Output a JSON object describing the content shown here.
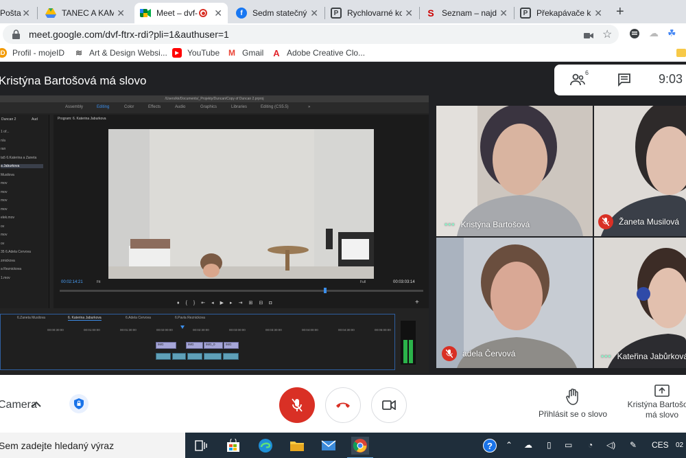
{
  "browser": {
    "tabs": [
      {
        "title": "Pošta",
        "icon": "mail-icon",
        "active": false
      },
      {
        "title": "TANEC A KAMERA",
        "icon": "google-drive-icon",
        "active": false
      },
      {
        "title": "Meet – dvf-ftrx-rdi",
        "icon": "google-meet-icon",
        "active": true
      },
      {
        "title": "Sedm statečných",
        "icon": "facebook-icon",
        "active": false
      },
      {
        "title": "Rychlovarné konvice",
        "icon": "shop-icon",
        "active": false
      },
      {
        "title": "Seznam – najdu tam",
        "icon": "seznam-icon",
        "active": false
      },
      {
        "title": "Překapávače kávy",
        "icon": "shop-icon",
        "active": false
      }
    ],
    "url": "meet.google.com/dvf-ftrx-rdi?pli=1&authuser=1",
    "bookmarks": [
      {
        "label": "Profil - mojeID",
        "icon": "mojeid-icon"
      },
      {
        "label": "Art & Design Websi...",
        "icon": "art-icon"
      },
      {
        "label": "YouTube",
        "icon": "youtube-icon"
      },
      {
        "label": "Gmail",
        "icon": "gmail-icon"
      },
      {
        "label": "Adobe Creative Clo...",
        "icon": "adobe-icon"
      }
    ]
  },
  "meet": {
    "presenter_banner": "Kristýna Bartošová má slovo",
    "participant_count": "6",
    "clock": "9:03",
    "participants": [
      {
        "name": "Kristýna Bartošová",
        "muted": false,
        "speaking": true
      },
      {
        "name": "Žaneta Musilová",
        "muted": true,
        "speaking": false
      },
      {
        "name": "adela Červová",
        "muted": true,
        "speaking": false
      },
      {
        "name": "Kateřina Jabůrková",
        "muted": false,
        "speaking": true
      }
    ],
    "bottom": {
      "camera_label": "Camera",
      "raise_hand": "Přihlásit se o slovo",
      "presenting_line1": "Kristýna Bartošová",
      "presenting_line2": "má slovo"
    },
    "colors": {
      "hangup": "#d93025",
      "accent": "#1a73e8"
    }
  },
  "premiere": {
    "file_path": "/Users/kk/Documents/_Projekty/Duncan/Copy of Duncan 2.prproj",
    "workspaces": [
      "Assembly",
      "Editing",
      "Color",
      "Effects",
      "Audio",
      "Graphics",
      "Libraries",
      "Editing (CS5.5)"
    ],
    "active_workspace": "Editing",
    "project_panel": "Duncan 2",
    "project_tab2": "Aud",
    "program_title": "Program: 6. Katerina Jaburkova",
    "project_items": [
      "1 of...",
      "n/a",
      "ran",
      "ta5 6.Katerina a Zaneta",
      "a Jaburkova",
      "Musilova",
      "mov",
      "mov",
      "mov",
      "mov",
      "elek.mov",
      "ov",
      "mov",
      "ov",
      "35 6.Adela Cervova",
      "zmickova",
      "a Reznickova",
      "1.mov"
    ],
    "timecode_current": "00:02:14:21",
    "timecode_duration": "00:03:03:14",
    "fit_label": "Fit",
    "full_label": "Full",
    "sequences": [
      "6.Zaneta Musilova",
      "6. Katerina Jaburkova",
      "6.Adela Cervova",
      "6.Pavla Reznickova"
    ],
    "ruler": [
      "00:00:30:00",
      "00:01:00:00",
      "00:01:30:00",
      "00:02:00:00",
      "00:02:30:00",
      "00:03:00:00",
      "00:03:30:00",
      "00:04:00:00",
      "00:04:30:00",
      "00:05:00:00"
    ],
    "clip_labels": [
      "IMG",
      "IMG",
      "IMG_0",
      "IMG"
    ]
  },
  "taskbar": {
    "search_text": "Sem zadejte hledaný výraz",
    "language": "CES",
    "time": "02"
  }
}
